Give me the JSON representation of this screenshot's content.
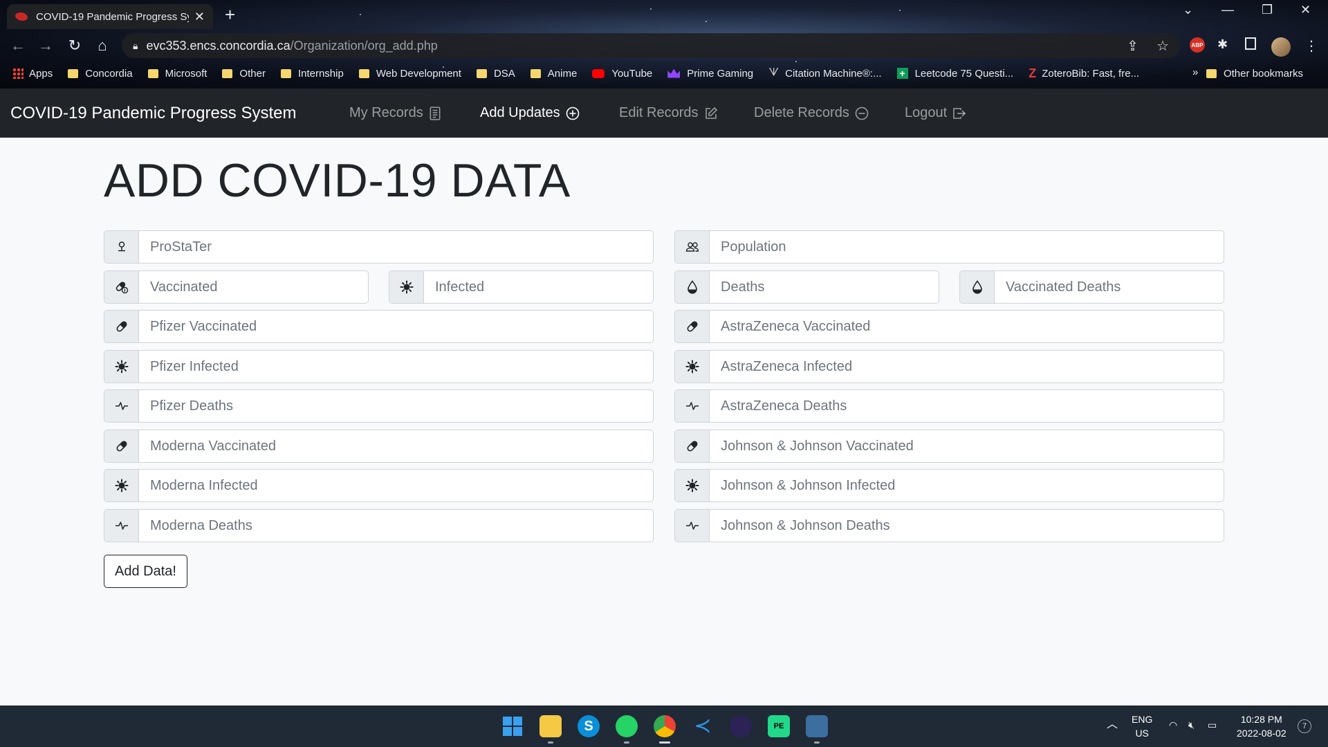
{
  "browser": {
    "tab_title": "COVID-19 Pandemic Progress Sy",
    "url_host": "evc353.encs.concordia.ca",
    "url_path": "/Organization/org_add.php",
    "bookmarks": [
      "Apps",
      "Concordia",
      "Microsoft",
      "Other",
      "Internship",
      "Web Development",
      "DSA",
      "Anime",
      "YouTube",
      "Prime Gaming",
      "Citation Machine®:...",
      "Leetcode 75 Questi...",
      "ZoteroBib: Fast, fre..."
    ],
    "other_bookmarks": "Other bookmarks",
    "abp_label": "ABP"
  },
  "navbar": {
    "brand": "COVID-19 Pandemic Progress System",
    "links": [
      {
        "label": "My Records",
        "icon": "journal-icon"
      },
      {
        "label": "Add Updates",
        "icon": "plus-circle-icon",
        "active": true
      },
      {
        "label": "Edit Records",
        "icon": "pencil-square-icon"
      },
      {
        "label": "Delete Records",
        "icon": "dash-circle-icon"
      },
      {
        "label": "Logout",
        "icon": "box-arrow-right-icon"
      }
    ]
  },
  "page": {
    "heading": "ADD COVID-19 DATA",
    "fields": {
      "prostater": "ProStaTer",
      "population": "Population",
      "vaccinated": "Vaccinated",
      "infected": "Infected",
      "deaths": "Deaths",
      "vaccinated_deaths": "Vaccinated Deaths",
      "pfizer_vaccinated": "Pfizer Vaccinated",
      "astrazeneca_vaccinated": "AstraZeneca Vaccinated",
      "pfizer_infected": "Pfizer Infected",
      "astrazeneca_infected": "AstraZeneca Infected",
      "pfizer_deaths": "Pfizer Deaths",
      "astrazeneca_deaths": "AstraZeneca Deaths",
      "moderna_vaccinated": "Moderna Vaccinated",
      "jj_vaccinated": "Johnson & Johnson Vaccinated",
      "moderna_infected": "Moderna Infected",
      "jj_infected": "Johnson & Johnson Infected",
      "moderna_deaths": "Moderna Deaths",
      "jj_deaths": "Johnson & Johnson Deaths"
    },
    "submit_label": "Add Data!"
  },
  "taskbar": {
    "lang_line1": "ENG",
    "lang_line2": "US",
    "time": "10:28 PM",
    "date": "2022-08-02",
    "notif_count": "7"
  },
  "colors": {
    "navbar_bg": "#212529",
    "page_bg": "#f8f9fa",
    "input_group_bg": "#e9ecef"
  }
}
